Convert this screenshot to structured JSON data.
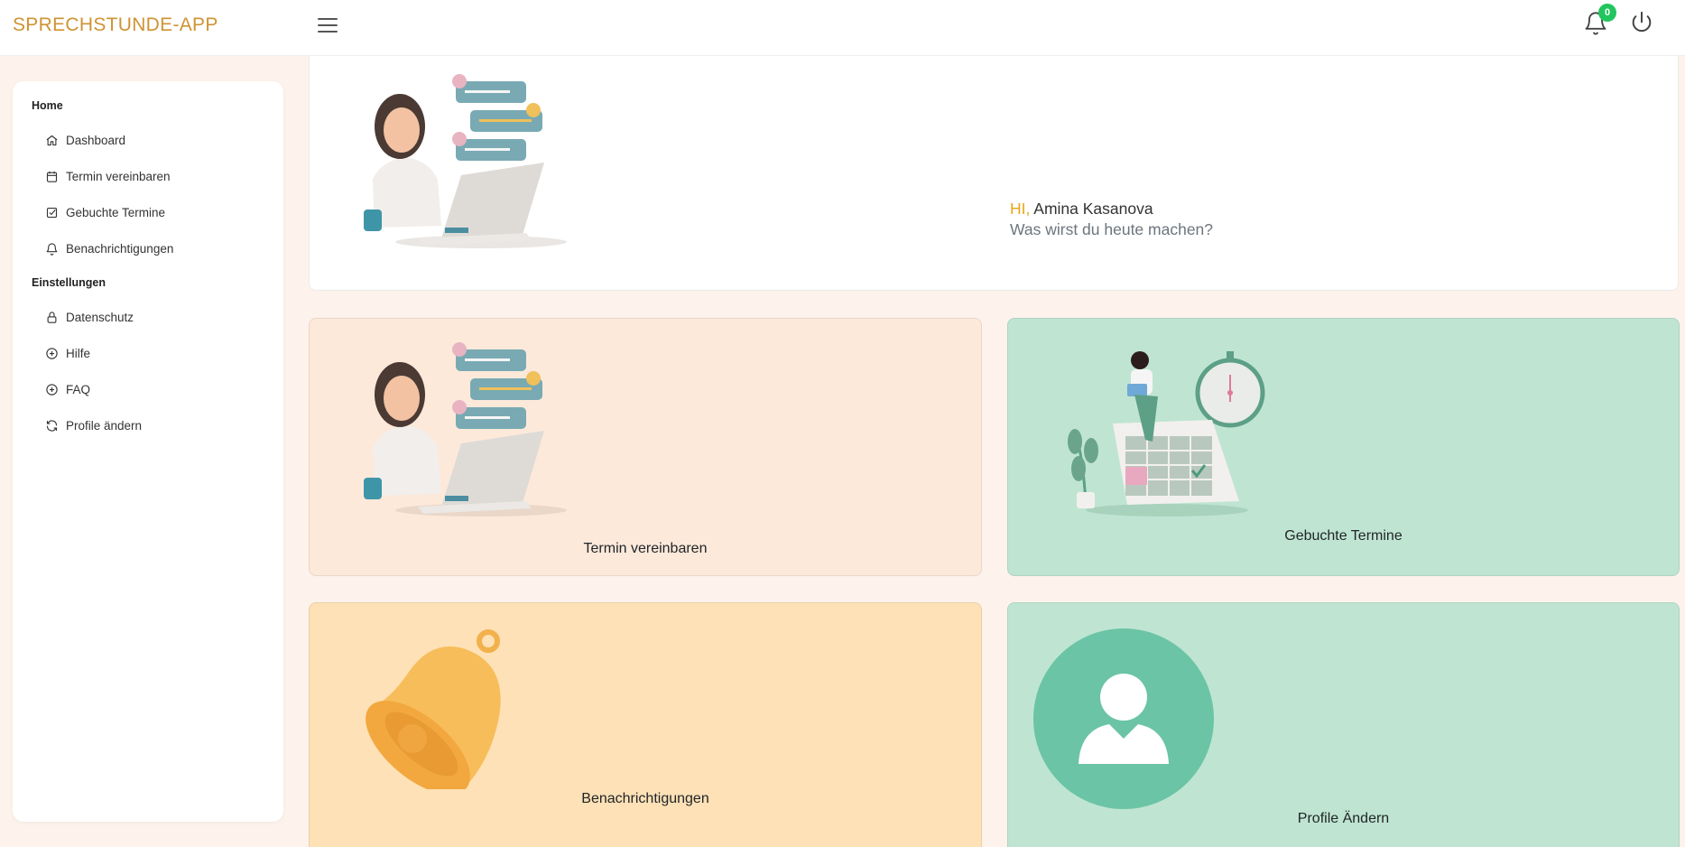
{
  "app": {
    "title": "SPRECHSTUNDE-APP"
  },
  "header": {
    "notification_count": "0"
  },
  "sidebar": {
    "sections": [
      {
        "title": "Home"
      },
      {
        "title": "Einstellungen"
      }
    ],
    "items": [
      {
        "label": "Dashboard",
        "icon": "home-icon"
      },
      {
        "label": "Termin vereinbaren",
        "icon": "calendar-icon"
      },
      {
        "label": "Gebuchte Termine",
        "icon": "checkbox-icon"
      },
      {
        "label": "Benachrichtigungen",
        "icon": "bell-icon"
      },
      {
        "label": "Datenschutz",
        "icon": "lock-icon"
      },
      {
        "label": "Hilfe",
        "icon": "plus-circle-icon"
      },
      {
        "label": "FAQ",
        "icon": "plus-circle-icon"
      },
      {
        "label": "Profile ändern",
        "icon": "refresh-icon"
      }
    ]
  },
  "hero": {
    "hi": "HI,",
    "name": "Amina Kasanova",
    "subtitle": "Was wirst du heute machen?"
  },
  "cards": [
    {
      "label": "Termin vereinbaren",
      "illustration": "woman-laptop-chat-illustration",
      "color": "#fde9da"
    },
    {
      "label": "Gebuchte Termine",
      "illustration": "calendar-clock-illustration",
      "color": "#bfe5d2"
    },
    {
      "label": "Benachrichtigungen",
      "illustration": "bell-illustration",
      "color": "#fee1b6"
    },
    {
      "label": "Profile Ändern",
      "illustration": "user-avatar-illustration",
      "color": "#bfe5d2"
    }
  ],
  "colors": {
    "brand": "#cf9333",
    "accent": "#e8a619",
    "badge": "#22c55e"
  }
}
